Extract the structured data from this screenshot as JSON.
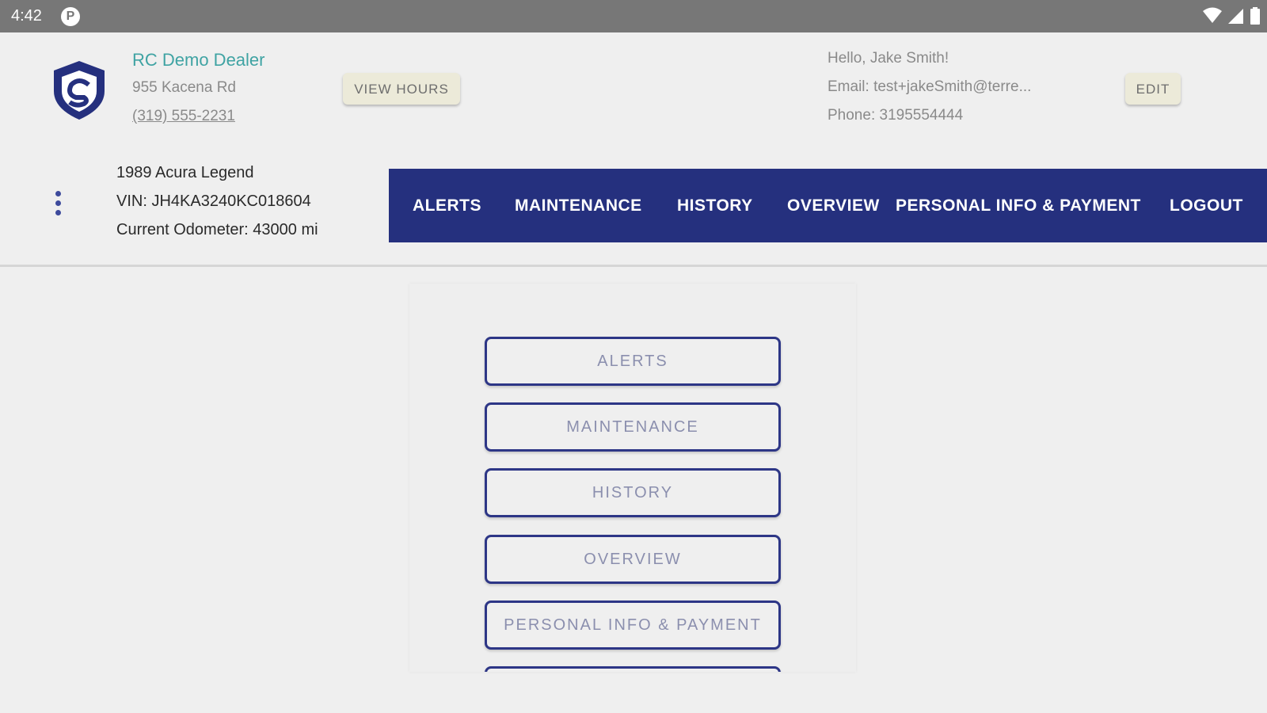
{
  "status_bar": {
    "time": "4:42",
    "p_icon_label": "P"
  },
  "dealer": {
    "name": "RC Demo Dealer",
    "address": "955 Kacena Rd",
    "phone": "(319) 555-2231",
    "view_hours_label": "VIEW HOURS"
  },
  "user": {
    "greeting": "Hello, Jake Smith!",
    "email": "Email: test+jakeSmith@terre...",
    "phone": "Phone: 3195554444",
    "edit_label": "EDIT"
  },
  "vehicle": {
    "name": "1989 Acura Legend",
    "vin": "VIN: JH4KA3240KC018604",
    "odometer": "Current Odometer: 43000 mi"
  },
  "nav": {
    "items": [
      {
        "label": "ALERTS"
      },
      {
        "label": "MAINTENANCE"
      },
      {
        "label": "HISTORY"
      },
      {
        "label": "OVERVIEW"
      },
      {
        "label": "PERSONAL INFO & PAYMENT"
      },
      {
        "label": "LOGOUT"
      }
    ]
  },
  "menu": {
    "buttons": [
      {
        "label": "ALERTS"
      },
      {
        "label": "MAINTENANCE"
      },
      {
        "label": "HISTORY"
      },
      {
        "label": "OVERVIEW"
      },
      {
        "label": "PERSONAL INFO & PAYMENT"
      }
    ]
  },
  "colors": {
    "nav_bg": "#25307e",
    "accent_teal": "#3fa3a3",
    "button_border": "#2d3686",
    "tan_button": "#ecead9"
  }
}
